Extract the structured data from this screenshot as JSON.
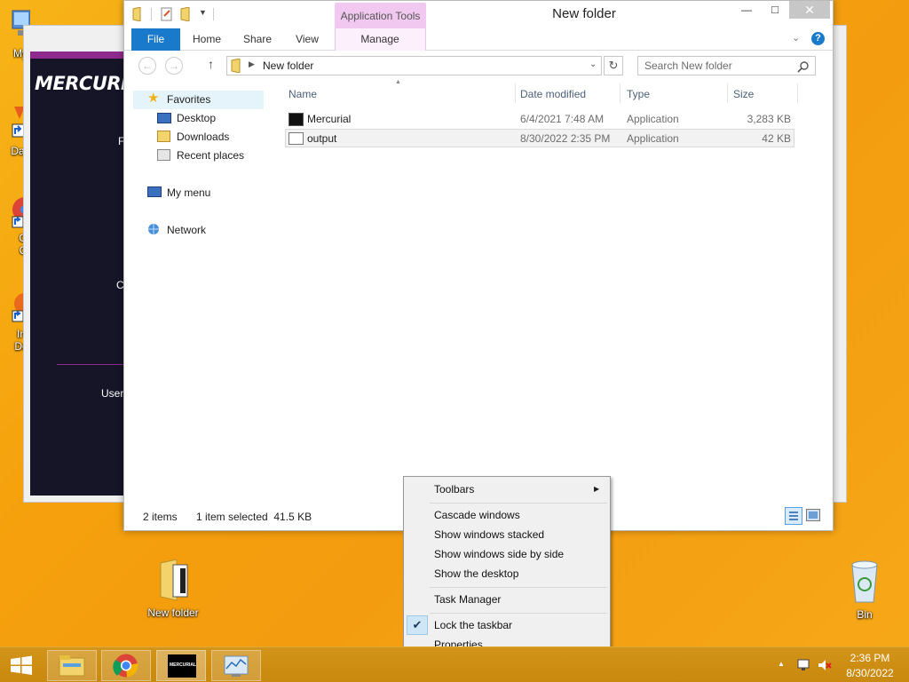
{
  "desktop_icons": [
    {
      "label": "My",
      "icon": "computer-icon"
    },
    {
      "label": "Data",
      "icon": "shortcut-icon"
    },
    {
      "label": "G",
      "icon": "chrome-icon"
    },
    {
      "label": "C",
      "icon": "chrome-icon"
    },
    {
      "label": "In",
      "icon": "shortcut-icon"
    },
    {
      "label": "Do",
      "icon": "shortcut-icon"
    },
    {
      "label": "New folder",
      "icon": "folder-icon"
    },
    {
      "label": "Bin",
      "icon": "recycle-bin-icon"
    }
  ],
  "mercurial_window": {
    "logo": "MERCURI",
    "texts": [
      "F",
      "C",
      "User"
    ]
  },
  "explorer": {
    "title": "New folder",
    "context_tab": "Application Tools",
    "tabs": [
      "File",
      "Home",
      "Share",
      "View",
      "Manage"
    ],
    "address": "New folder",
    "search_placeholder": "Search New folder",
    "nav": {
      "favorites": "Favorites",
      "desktop": "Desktop",
      "downloads": "Downloads",
      "recent": "Recent places",
      "my_menu": "My menu",
      "network": "Network"
    },
    "columns": [
      "Name",
      "Date modified",
      "Type",
      "Size"
    ],
    "files": [
      {
        "name": "Mercurial",
        "date": "6/4/2021 7:48 AM",
        "type": "Application",
        "size": "3,283 KB"
      },
      {
        "name": "output",
        "date": "8/30/2022 2:35 PM",
        "type": "Application",
        "size": "42 KB"
      }
    ],
    "status": {
      "count": "2 items",
      "selected": "1 item selected  41.5 KB"
    }
  },
  "context_menu": {
    "toolbars": "Toolbars",
    "cascade": "Cascade windows",
    "stacked": "Show windows stacked",
    "side_by_side": "Show windows side by side",
    "show_desktop": "Show the desktop",
    "task_manager": "Task Manager",
    "lock_taskbar": "Lock the taskbar",
    "properties": "Properties"
  },
  "taskbar": {
    "mercurial_label": "MERCURIAL",
    "time": "2:36 PM",
    "date": "8/30/2022"
  },
  "colors": {
    "file_tab": "#1979ca",
    "app_tools": "#f0c8f0",
    "desktop": "#f5a00c"
  }
}
